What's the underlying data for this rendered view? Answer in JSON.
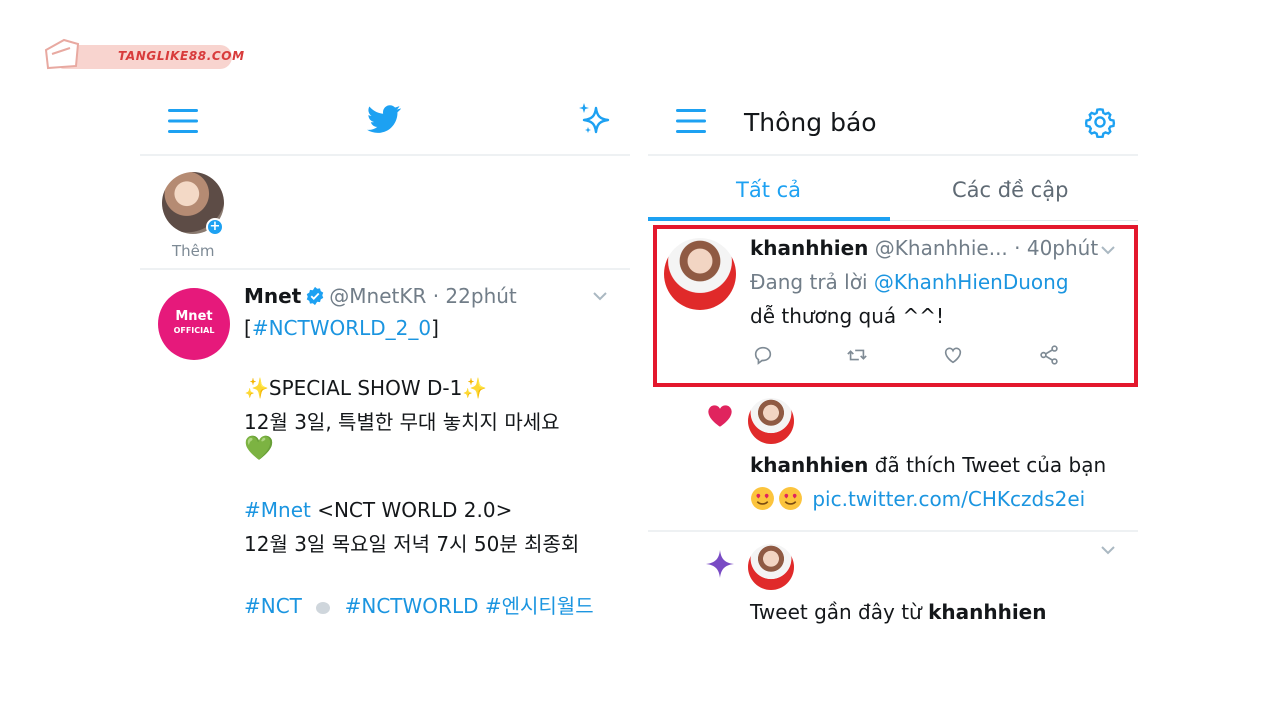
{
  "watermark": {
    "text": "TANGLIKE88.COM"
  },
  "colors": {
    "twitter_blue": "#1da1f2",
    "link_blue": "#1b95e0",
    "highlight_red": "#e3182d",
    "mnet_pink": "#e6197b"
  },
  "left": {
    "icons": {
      "menu": "menu-icon",
      "logo": "twitter-bird-icon",
      "top": "sparkle-icon"
    },
    "fleet": {
      "label": "Thêm"
    },
    "tweet": {
      "avatar_text_main": "Mnet",
      "avatar_text_sub": "OFFICIAL",
      "name": "Mnet",
      "handle": "@MnetKR · 22phút",
      "hashtag_open": "[",
      "hashtag": "#NCTWORLD_2_0",
      "hashtag_close": "]",
      "special_show": "SPECIAL SHOW D-1",
      "korean_line1": "12월 3일, 특별한 무대 놓치지 마세요",
      "green_heart": "💚",
      "mnet_tag": "#Mnet",
      "show_title": " <NCT WORLD 2.0>",
      "korean_line2": "12월 3일 목요일 저녁 7시 50분 최종회",
      "tag_nct": "#NCT",
      "tag_nctworld": "#NCTWORLD",
      "tag_korean": "#엔시티월드"
    }
  },
  "right": {
    "title": "Thông báo",
    "tabs": [
      {
        "label": "Tất cả",
        "active": true
      },
      {
        "label": "Các đề cập",
        "active": false
      }
    ],
    "reply_notification": {
      "name": "khanhhien",
      "handle": "@Khanhhie... · 40phút",
      "replying_prefix": "Đang trả lời ",
      "replying_to": "@KhanhHienDuong",
      "text": "dễ thương quá ^^!"
    },
    "like_notification": {
      "name": "khanhhien",
      "action": " đã thích Tweet của bạn",
      "link": "pic.twitter.com/CHKczds2ei"
    },
    "recent_notification": {
      "prefix": "Tweet gần đây từ ",
      "name": "khanhhien"
    }
  }
}
